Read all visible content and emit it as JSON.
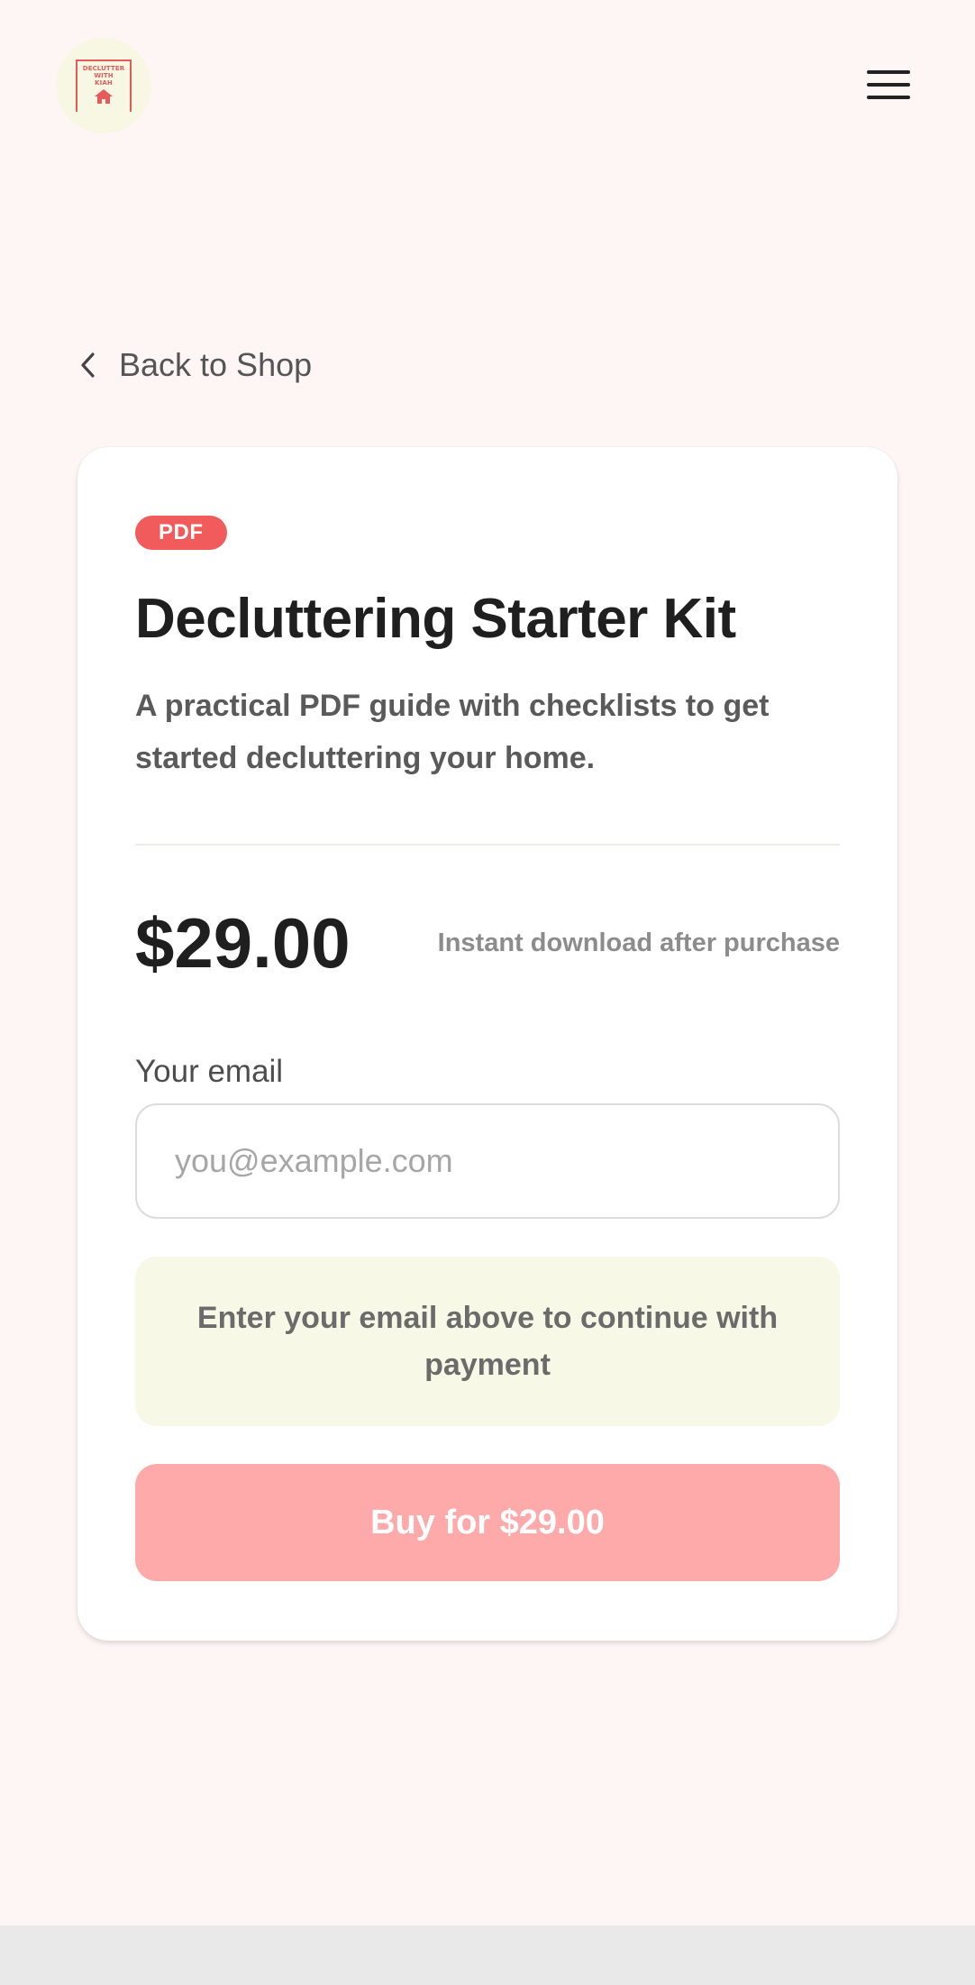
{
  "header": {
    "logo": {
      "text_line1": "DECLUTTER",
      "text_line2": "WITH",
      "text_line3": "KIAH",
      "icon": "house-icon"
    },
    "menu_icon": "hamburger-menu-icon"
  },
  "back_link": {
    "label": "Back to Shop",
    "icon": "chevron-left-icon"
  },
  "product": {
    "badge": "PDF",
    "title": "Decluttering Starter Kit",
    "description": "A practical PDF guide with checklists to get started decluttering your home.",
    "price": "$29.00",
    "delivery_note": "Instant download after purchase"
  },
  "checkout": {
    "email_label": "Your email",
    "email_value": "",
    "email_placeholder": "you@example.com",
    "notice": "Enter your email above to continue with payment",
    "buy_label": "Buy for $29.00",
    "buy_disabled": true
  },
  "colors": {
    "background": "#fdf6f5",
    "accent": "#f15b5b",
    "button_disabled": "#feaaaa",
    "notice_bg": "#f8f8e6",
    "logo_bg": "#f7f7e4"
  }
}
